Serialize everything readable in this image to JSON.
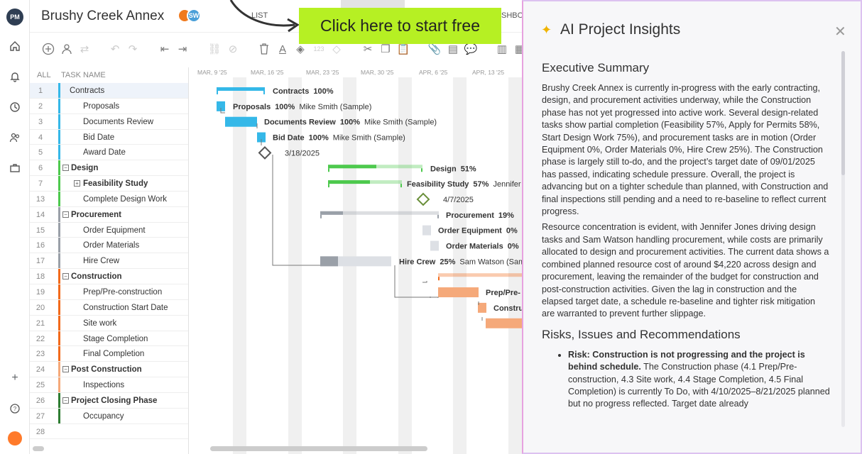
{
  "app": {
    "logo_text": "PM",
    "project_title": "Brushy Creek Annex",
    "avatar_initials": "SW",
    "view_list_label": "LIST",
    "view_dashboard_label": "SHBO",
    "cta_label": "Click here to start free"
  },
  "toolbar": {
    "icons": [
      "add-task-icon",
      "add-user-icon",
      "link-icon",
      "undo-icon",
      "redo-icon",
      "outdent-icon",
      "indent-icon",
      "link-chain-icon",
      "unlink-icon",
      "delete-icon",
      "text-color-icon",
      "fill-color-icon",
      "number-icon",
      "milestone-icon",
      "cut-icon",
      "copy-icon",
      "paste-icon",
      "attachment-icon",
      "notes-icon",
      "comment-icon",
      "columns-icon",
      "table-icon"
    ],
    "number_label": "123"
  },
  "grid": {
    "header_all": "ALL",
    "header_task_name": "TASK NAME",
    "rows": [
      {
        "num": "1",
        "name": "Contracts",
        "level": 0,
        "summary": false,
        "color": "#35b8e8",
        "selected": true
      },
      {
        "num": "2",
        "name": "Proposals",
        "level": 1,
        "summary": false,
        "color": "#35b8e8"
      },
      {
        "num": "3",
        "name": "Documents Review",
        "level": 1,
        "summary": false,
        "color": "#35b8e8"
      },
      {
        "num": "4",
        "name": "Bid Date",
        "level": 1,
        "summary": false,
        "color": "#35b8e8"
      },
      {
        "num": "5",
        "name": "Award Date",
        "level": 1,
        "summary": false,
        "color": "#35b8e8"
      },
      {
        "num": "6",
        "name": "Design",
        "level": 0,
        "summary": true,
        "color": "#4dc94d"
      },
      {
        "num": "7",
        "name": "Feasibility Study",
        "level": 1,
        "summary": true,
        "color": "#4dc94d",
        "toggle": "+"
      },
      {
        "num": "13",
        "name": "Complete Design Work",
        "level": 1,
        "summary": false,
        "color": "#4dc94d"
      },
      {
        "num": "14",
        "name": "Procurement",
        "level": 0,
        "summary": true,
        "color": "#9aa0a8"
      },
      {
        "num": "15",
        "name": "Order Equipment",
        "level": 1,
        "summary": false,
        "color": "#9aa0a8"
      },
      {
        "num": "16",
        "name": "Order Materials",
        "level": 1,
        "summary": false,
        "color": "#9aa0a8"
      },
      {
        "num": "17",
        "name": "Hire Crew",
        "level": 1,
        "summary": false,
        "color": "#9aa0a8"
      },
      {
        "num": "18",
        "name": "Construction",
        "level": 0,
        "summary": true,
        "color": "#f26a1b"
      },
      {
        "num": "19",
        "name": "Prep/Pre-construction",
        "level": 1,
        "summary": false,
        "color": "#f26a1b"
      },
      {
        "num": "20",
        "name": "Construction Start Date",
        "level": 1,
        "summary": false,
        "color": "#f26a1b"
      },
      {
        "num": "21",
        "name": "Site work",
        "level": 1,
        "summary": false,
        "color": "#f26a1b"
      },
      {
        "num": "22",
        "name": "Stage Completion",
        "level": 1,
        "summary": false,
        "color": "#f26a1b"
      },
      {
        "num": "23",
        "name": "Final Completion",
        "level": 1,
        "summary": false,
        "color": "#f26a1b"
      },
      {
        "num": "24",
        "name": "Post Construction",
        "level": 0,
        "summary": true,
        "color": "#f5a97a"
      },
      {
        "num": "25",
        "name": "Inspections",
        "level": 1,
        "summary": false,
        "color": "#f5a97a"
      },
      {
        "num": "26",
        "name": "Project Closing Phase",
        "level": 0,
        "summary": true,
        "color": "#2e7d32"
      },
      {
        "num": "27",
        "name": "Occupancy",
        "level": 1,
        "summary": false,
        "color": "#2e7d32"
      },
      {
        "num": "28",
        "name": "",
        "level": 1,
        "summary": false,
        "color": ""
      }
    ]
  },
  "gantt": {
    "dates": [
      "MAR, 9 '25",
      "MAR, 16 '25",
      "MAR, 23 '25",
      "MAR, 30 '25",
      "APR, 6 '25",
      "APR, 13 '25"
    ],
    "labels": [
      {
        "task": "Contracts",
        "percent": "100%",
        "assignee": ""
      },
      {
        "task": "Proposals",
        "percent": "100%",
        "assignee": "Mike Smith (Sample)"
      },
      {
        "task": "Documents Review",
        "percent": "100%",
        "assignee": "Mike Smith (Sample)"
      },
      {
        "task": "Bid Date",
        "percent": "100%",
        "assignee": "Mike Smith (Sample)"
      },
      {
        "task": "",
        "percent": "",
        "assignee": "3/18/2025"
      },
      {
        "task": "Design",
        "percent": "51%",
        "assignee": ""
      },
      {
        "task": "Feasibility Study",
        "percent": "57%",
        "assignee": "Jennifer"
      },
      {
        "task": "",
        "percent": "",
        "assignee": "4/7/2025"
      },
      {
        "task": "Procurement",
        "percent": "19%",
        "assignee": ""
      },
      {
        "task": "Order Equipment",
        "percent": "0%",
        "assignee": "S"
      },
      {
        "task": "Order Materials",
        "percent": "0%",
        "assignee": "S"
      },
      {
        "task": "Hire Crew",
        "percent": "25%",
        "assignee": "Sam Watson (Sam"
      },
      {
        "task": "",
        "percent": "",
        "assignee": ""
      },
      {
        "task": "Prep/Pre-",
        "percent": "",
        "assignee": ""
      },
      {
        "task": "Constru",
        "percent": "",
        "assignee": ""
      }
    ]
  },
  "panel": {
    "title": "AI Project Insights",
    "section1_heading": "Executive Summary",
    "para1": "Brushy Creek Annex is currently in-progress with the early contracting, design, and procurement activities underway, while the Construction phase has not yet progressed into active work. Several design-related tasks show partial completion (Feasibility 57%, Apply for Permits 58%, Start Design Work 75%), and procurement tasks are in motion (Order Equipment 0%, Order Materials 0%, Hire Crew 25%). The Construction phase is largely still to-do, and the project’s target date of 09/01/2025 has passed, indicating schedule pressure. Overall, the project is advancing but on a tighter schedule than planned, with Construction and final inspections still pending and a need to re-baseline to reflect current progress.",
    "para2": "Resource concentration is evident, with Jennifer Jones driving design tasks and Sam Watson handling procurement, while costs are primarily allocated to design and procurement activities. The current data shows a combined planned resource cost of around $4,220 across design and procurement, leaving the remainder of the budget for construction and post-construction activities. Given the lag in construction and the elapsed target date, a schedule re-baseline and tighter risk mitigation are warranted to prevent further slippage.",
    "section2_heading": "Risks, Issues and Recommendations",
    "bullet1_bold": "Risk: Construction is not progressing and the project is behind schedule.",
    "bullet1_text": " The Construction phase (4.1 Prep/Pre-construction, 4.3 Site work, 4.4 Stage Completion, 4.5 Final Completion) is currently To Do, with 4/10/2025–8/21/2025 planned but no progress reflected. Target date already"
  }
}
